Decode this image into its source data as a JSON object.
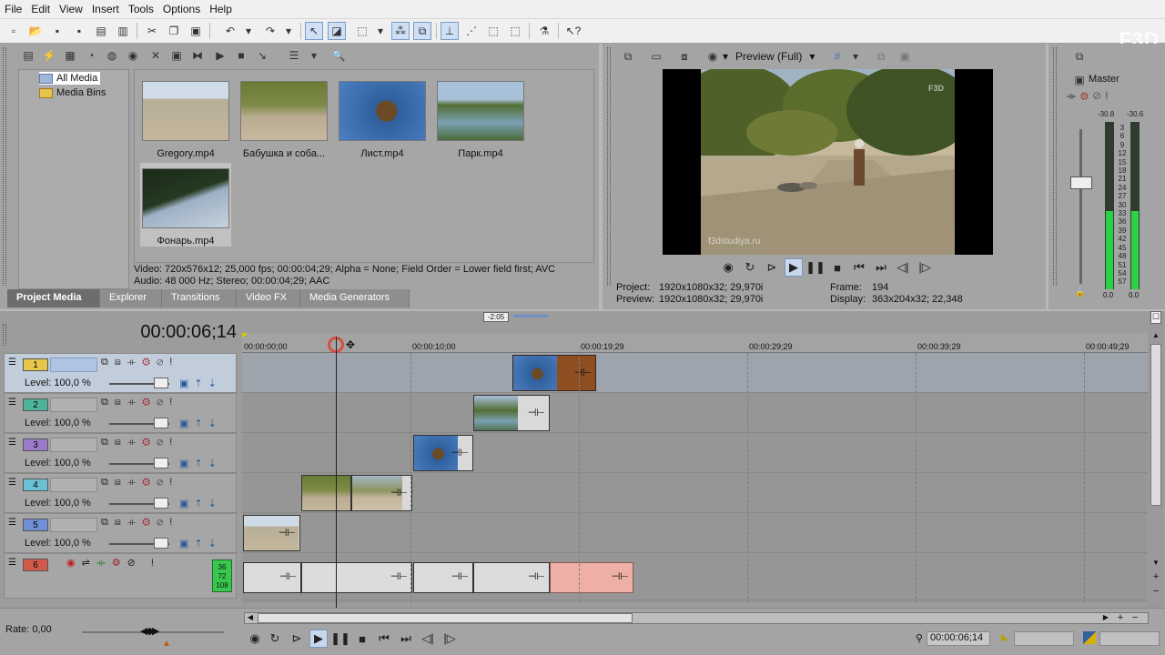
{
  "menu": [
    "File",
    "Edit",
    "View",
    "Insert",
    "Tools",
    "Options",
    "Help"
  ],
  "watermark": "F3D",
  "media_tree": {
    "items": [
      "All Media",
      "Media Bins"
    ]
  },
  "media_files": [
    {
      "name": "Gregory.mp4",
      "colors": [
        "#b2ab9a",
        "#d2c7ad"
      ]
    },
    {
      "name": "Бабушка и соба...",
      "colors": [
        "#6d7c3c",
        "#b8a88a"
      ]
    },
    {
      "name": "Лист.mp4",
      "colors": [
        "#3b6fb3",
        "#5b4224"
      ]
    },
    {
      "name": "Парк.mp4",
      "colors": [
        "#95b1cc",
        "#4e6d3a"
      ]
    },
    {
      "name": "Фонарь.mp4",
      "colors": [
        "#203a1f",
        "#8ea3b8"
      ]
    }
  ],
  "media_info": {
    "line1": "Video: 720x576x12; 25,000 fps; 00:00:04;29; Alpha = None; Field Order = Lower field first; AVC",
    "line2": "Audio: 48 000 Hz; Stereo; 00:00:04;29; AAC"
  },
  "tabs": [
    "Project Media",
    "Explorer",
    "Transitions",
    "Video FX",
    "Media Generators"
  ],
  "preview": {
    "mode": "Preview (Full)",
    "project_label": "Project:",
    "project_value": "1920x1080x32; 29,970i",
    "preview_label": "Preview:",
    "preview_value": "1920x1080x32; 29,970i",
    "frame_label": "Frame:",
    "frame_value": "194",
    "display_label": "Display:",
    "display_value": "363x204x32; 22,348",
    "overlay_text": "f3dstudiya.ru",
    "logo_text": "F3D"
  },
  "master": {
    "title": "Master",
    "peak_left": "-30.8",
    "peak_right": "-30.6",
    "scale": [
      "3",
      "6",
      "9",
      "12",
      "15",
      "18",
      "21",
      "24",
      "27",
      "30",
      "33",
      "36",
      "39",
      "42",
      "45",
      "48",
      "51",
      "54",
      "57"
    ],
    "bottom_left": "0.0",
    "bottom_right": "0.0"
  },
  "timeline": {
    "timecode": "00:00:06;14",
    "loop_length": "-2:05",
    "ruler_labels": [
      "00:00:00;00",
      "00:00:10;00",
      "00:00:19;29",
      "00:00:29;29",
      "00:00:39;29",
      "00:00:49;29"
    ],
    "tracks": [
      {
        "num": "1",
        "level": "Level: 100,0 %",
        "color": "#e8c64a"
      },
      {
        "num": "2",
        "level": "Level: 100,0 %",
        "color": "#4db39a"
      },
      {
        "num": "3",
        "level": "Level: 100,0 %",
        "color": "#9b7bc7"
      },
      {
        "num": "4",
        "level": "Level: 100,0 %",
        "color": "#6cc0d6"
      },
      {
        "num": "5",
        "level": "Level: 100,0 %",
        "color": "#6f8fd6"
      },
      {
        "num": "6",
        "level": "",
        "color": "#d25a4a"
      }
    ],
    "audio_meter": [
      "36",
      "72",
      "108"
    ]
  },
  "bottom": {
    "rate": "Rate: 0,00",
    "timecode": "00:00:06;14"
  }
}
